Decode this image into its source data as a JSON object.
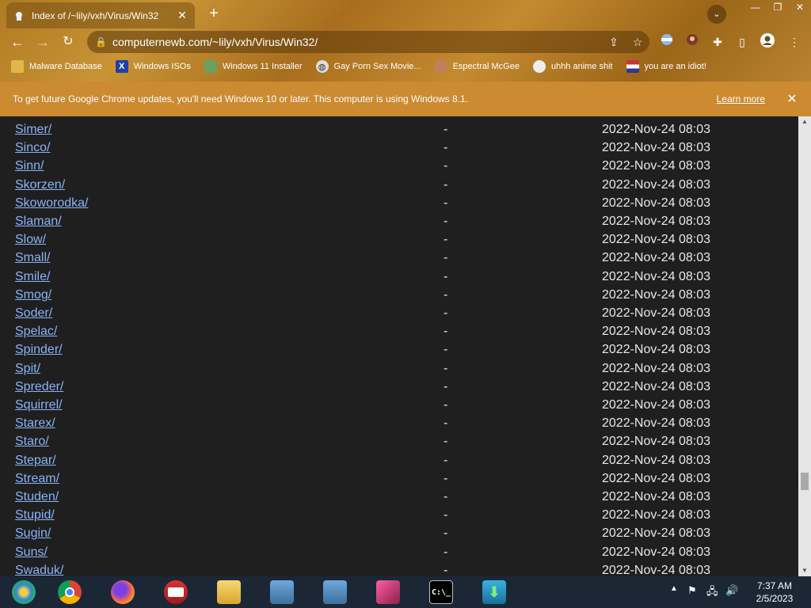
{
  "tab": {
    "title": "Index of /~lily/vxh/Virus/Win32",
    "close": "✕"
  },
  "newtab": "+",
  "window": {
    "minimize": "—",
    "restore": "❐",
    "close": "✕"
  },
  "address": {
    "url": "computernewb.com/~lily/vxh/Virus/Win32/"
  },
  "bookmarks": [
    {
      "label": "Malware Database",
      "icon": "folder-icon"
    },
    {
      "label": "Windows ISOs",
      "icon": "x-logo-icon"
    },
    {
      "label": "Windows 11 Installer",
      "icon": "image-icon"
    },
    {
      "label": "Gay Porn Sex Movie...",
      "icon": "globe-icon"
    },
    {
      "label": "Espectral McGee",
      "icon": "face-icon"
    },
    {
      "label": "uhhh anime shit",
      "icon": "anime-icon"
    },
    {
      "label": "you are an idiot!",
      "icon": "flag-icon"
    }
  ],
  "infobar": {
    "message": "To get future Google Chrome updates, you'll need Windows 10 or later. This computer is using Windows 8.1.",
    "learn_more": "Learn more",
    "close": "✕"
  },
  "listing": [
    {
      "name": "Simer/",
      "size": "-",
      "date": "2022-Nov-24 08:03"
    },
    {
      "name": "Sinco/",
      "size": "-",
      "date": "2022-Nov-24 08:03"
    },
    {
      "name": "Sinn/",
      "size": "-",
      "date": "2022-Nov-24 08:03"
    },
    {
      "name": "Skorzen/",
      "size": "-",
      "date": "2022-Nov-24 08:03"
    },
    {
      "name": "Skoworodka/",
      "size": "-",
      "date": "2022-Nov-24 08:03"
    },
    {
      "name": "Slaman/",
      "size": "-",
      "date": "2022-Nov-24 08:03"
    },
    {
      "name": "Slow/",
      "size": "-",
      "date": "2022-Nov-24 08:03"
    },
    {
      "name": "Small/",
      "size": "-",
      "date": "2022-Nov-24 08:03"
    },
    {
      "name": "Smile/",
      "size": "-",
      "date": "2022-Nov-24 08:03"
    },
    {
      "name": "Smog/",
      "size": "-",
      "date": "2022-Nov-24 08:03"
    },
    {
      "name": "Soder/",
      "size": "-",
      "date": "2022-Nov-24 08:03"
    },
    {
      "name": "Spelac/",
      "size": "-",
      "date": "2022-Nov-24 08:03"
    },
    {
      "name": "Spinder/",
      "size": "-",
      "date": "2022-Nov-24 08:03"
    },
    {
      "name": "Spit/",
      "size": "-",
      "date": "2022-Nov-24 08:03"
    },
    {
      "name": "Spreder/",
      "size": "-",
      "date": "2022-Nov-24 08:03"
    },
    {
      "name": "Squirrel/",
      "size": "-",
      "date": "2022-Nov-24 08:03"
    },
    {
      "name": "Starex/",
      "size": "-",
      "date": "2022-Nov-24 08:03"
    },
    {
      "name": "Staro/",
      "size": "-",
      "date": "2022-Nov-24 08:03"
    },
    {
      "name": "Stepar/",
      "size": "-",
      "date": "2022-Nov-24 08:03"
    },
    {
      "name": "Stream/",
      "size": "-",
      "date": "2022-Nov-24 08:03"
    },
    {
      "name": "Studen/",
      "size": "-",
      "date": "2022-Nov-24 08:03"
    },
    {
      "name": "Stupid/",
      "size": "-",
      "date": "2022-Nov-24 08:03"
    },
    {
      "name": "Sugin/",
      "size": "-",
      "date": "2022-Nov-24 08:03"
    },
    {
      "name": "Suns/",
      "size": "-",
      "date": "2022-Nov-24 08:03"
    },
    {
      "name": "Swaduk/",
      "size": "-",
      "date": "2022-Nov-24 08:03"
    }
  ],
  "taskbar": {
    "apps": [
      {
        "name": "windows-start",
        "label": ""
      },
      {
        "name": "chrome",
        "label": ""
      },
      {
        "name": "firefox",
        "label": ""
      },
      {
        "name": "opera",
        "label": ""
      },
      {
        "name": "file-explorer",
        "label": ""
      },
      {
        "name": "installer-1",
        "label": ""
      },
      {
        "name": "installer-2",
        "label": ""
      },
      {
        "name": "display-app",
        "label": ""
      },
      {
        "name": "command-prompt",
        "label": "C:\\_"
      },
      {
        "name": "download-app",
        "label": ""
      }
    ],
    "time": "7:37 AM",
    "date": "2/5/2023"
  },
  "colors": {
    "link": "#8ab4f8",
    "infobar": "#cc8a31",
    "page_bg": "#1f1f1f",
    "taskbar": "#1b2735"
  }
}
